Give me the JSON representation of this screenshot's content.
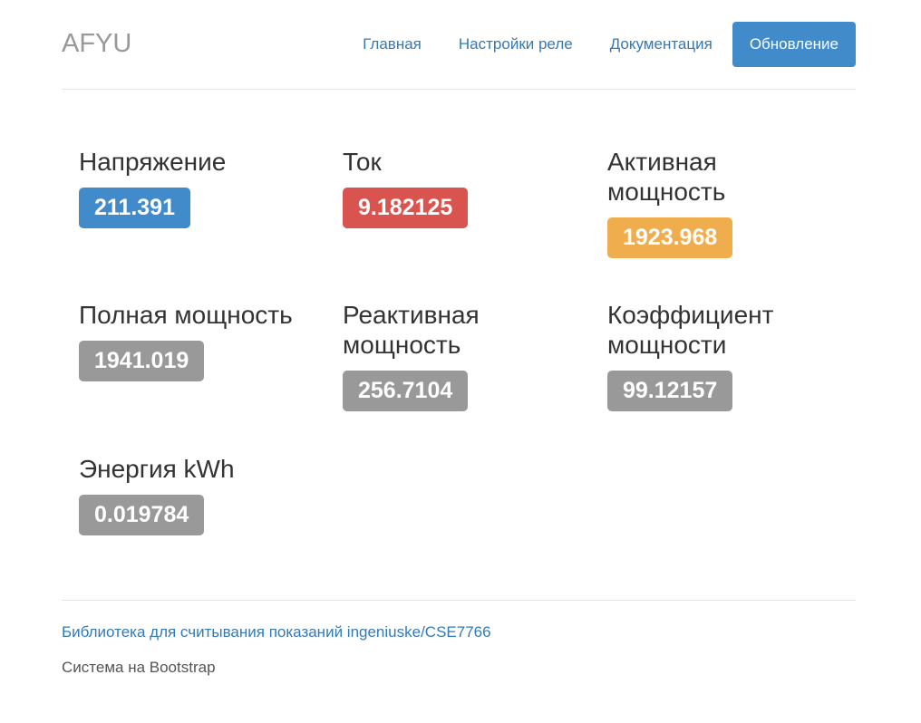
{
  "header": {
    "brand": "AFYU",
    "nav": [
      {
        "label": "Главная"
      },
      {
        "label": "Настройки реле"
      },
      {
        "label": "Документация"
      },
      {
        "label": "Обновление"
      }
    ]
  },
  "metrics": [
    {
      "title": "Напряжение",
      "value": "211.391",
      "color": "#428bca"
    },
    {
      "title": "Ток",
      "value": "9.182125",
      "color": "#d9534f"
    },
    {
      "title": "Активная мощность",
      "value": "1923.968",
      "color": "#f0ad4e"
    },
    {
      "title": "Полная мощность",
      "value": "1941.019",
      "color": "#999999"
    },
    {
      "title": "Реактивная мощность",
      "value": "256.7104",
      "color": "#999999"
    },
    {
      "title": "Коэффициент мощности",
      "value": "99.12157",
      "color": "#999999"
    },
    {
      "title": "Энергия kWh",
      "value": "0.019784",
      "color": "#999999"
    }
  ],
  "footer": {
    "link": "Библиотека для считывания показаний ingeniuske/CSE7766",
    "note": "Система на Bootstrap"
  }
}
